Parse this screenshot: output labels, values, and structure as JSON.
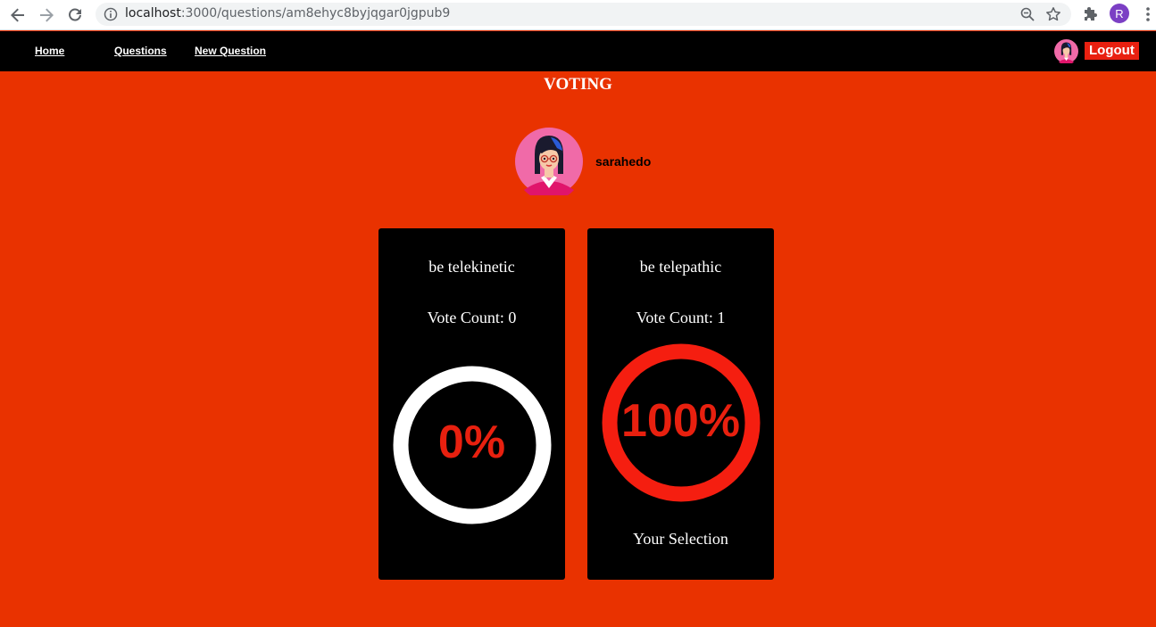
{
  "browser": {
    "url_host": "localhost",
    "url_rest": ":3000/questions/am8ehyc8byjqgar0jgpub9",
    "profile_initial": "R"
  },
  "nav": {
    "home": "Home",
    "questions": "Questions",
    "new_question": "New Question",
    "logout": "Logout"
  },
  "page": {
    "title": "VOTING"
  },
  "author": {
    "name": "sarahedo"
  },
  "options": [
    {
      "text": "be telekinetic",
      "vote_label": "Vote Count: ",
      "vote_count": "0",
      "percent_label": "0%",
      "percent": 0,
      "selected": false
    },
    {
      "text": "be telepathic",
      "vote_label": "Vote Count: ",
      "vote_count": "1",
      "percent_label": "100%",
      "percent": 100,
      "selected": true,
      "selection_label": "Your Selection"
    }
  ],
  "colors": {
    "page_bg": "#e93200",
    "accent": "#e8200f",
    "card_bg": "#000000",
    "ring_unselected": "#ffffff",
    "ring_selected": "#f51e10"
  }
}
